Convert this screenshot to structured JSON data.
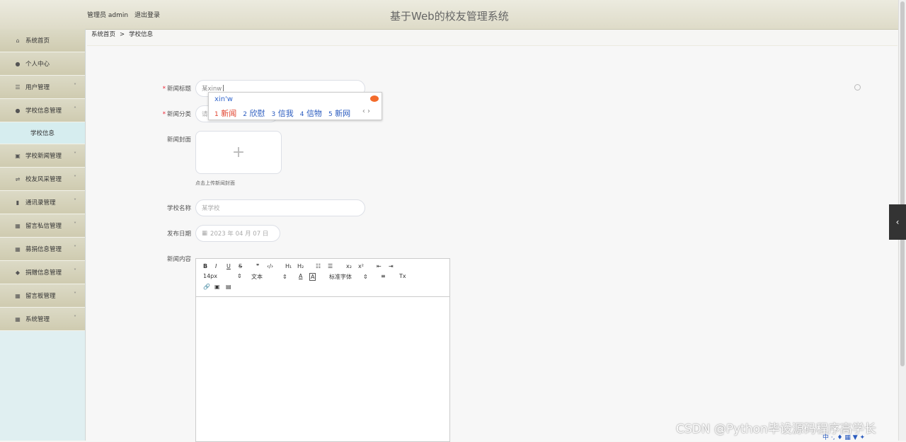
{
  "header": {
    "admin_label": "管理员 admin",
    "logout": "退出登录",
    "title": "基于Web的校友管理系统"
  },
  "sidebar": {
    "items": [
      {
        "label": "系统首页",
        "icon": "home-icon"
      },
      {
        "label": "个人中心",
        "icon": "user-icon"
      },
      {
        "label": "用户管理",
        "icon": "list-icon"
      },
      {
        "label": "学校信息管理",
        "icon": "user-icon"
      },
      {
        "label": "学校新闻管理",
        "icon": "note-icon"
      },
      {
        "label": "校友风采管理",
        "icon": "sliders-icon"
      },
      {
        "label": "通讯录管理",
        "icon": "bar-chart-icon"
      },
      {
        "label": "留言私信管理",
        "icon": "grid-icon"
      },
      {
        "label": "募捐信息管理",
        "icon": "grid-icon"
      },
      {
        "label": "捐赠信息管理",
        "icon": "thumb-icon"
      },
      {
        "label": "留言板管理",
        "icon": "grid-icon"
      },
      {
        "label": "系统管理",
        "icon": "grid-icon"
      }
    ],
    "subitem": "学校信息"
  },
  "breadcrumb": {
    "home": "系统首页",
    "sep": ">",
    "current": "学校信息"
  },
  "form": {
    "title_label": "新闻标题",
    "title_value": "某xinw",
    "category_label": "新闻分类",
    "category_placeholder": "请",
    "cover_label": "新闻封面",
    "cover_plus": "+",
    "cover_tip": "点击上传新闻封面",
    "school_label": "学校名称",
    "school_placeholder": "某学校",
    "date_label": "发布日期",
    "date_value": "2023 年 04 月 07 日",
    "content_label": "新闻内容"
  },
  "editor": {
    "bold": "B",
    "italic": "I",
    "underline": "U",
    "strike": "S",
    "quote": "❞",
    "code": "‹/›",
    "h1": "H₁",
    "h2": "H₂",
    "ol": "☷",
    "ul": "☰",
    "sub": "x₂",
    "sup": "x²",
    "outdent": "⇤",
    "indent": "⇥",
    "size": "14px",
    "text": "文本",
    "font": "标准字体",
    "color": "A",
    "bg": "A",
    "align": "≡",
    "clear": "Tx"
  },
  "ime": {
    "pinyin": "xin'w",
    "candidates": [
      {
        "num": "1",
        "word": "新闻"
      },
      {
        "num": "2",
        "word": "欣慰"
      },
      {
        "num": "3",
        "word": "信我"
      },
      {
        "num": "4",
        "word": "信物"
      },
      {
        "num": "5",
        "word": "新网"
      }
    ],
    "nav": "‹ ›"
  },
  "watermark": "CSDN @Python毕设源码程序高学长",
  "tray": "中 ·, ♦ ▦ ▼ ✦"
}
